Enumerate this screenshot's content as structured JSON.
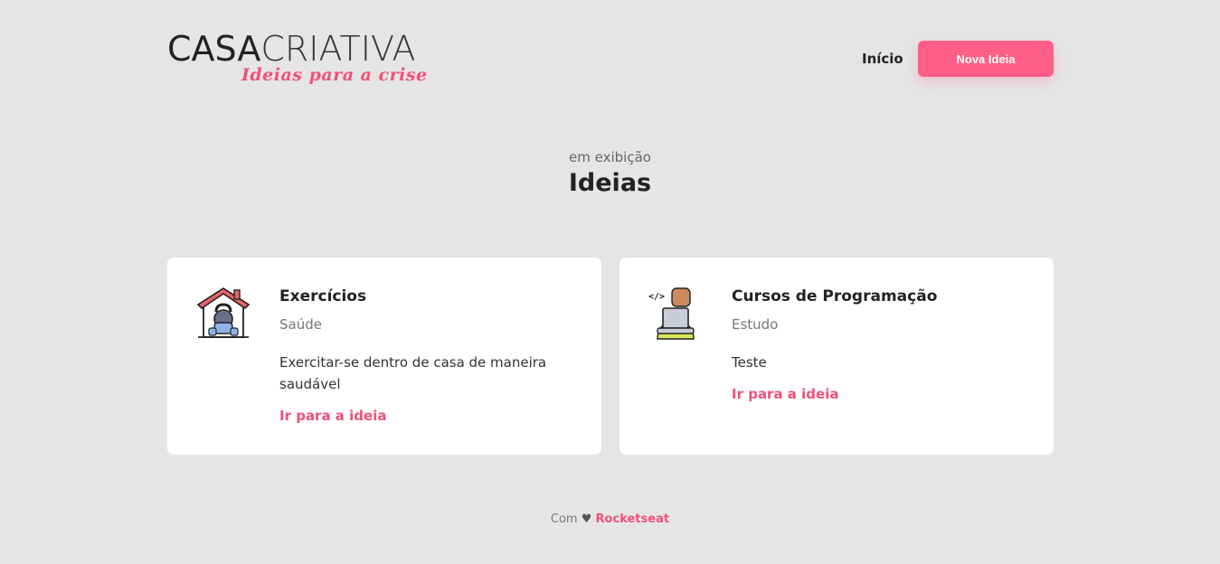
{
  "header": {
    "logo_bold": "CASA",
    "logo_light": "CRIATIVA",
    "logo_tagline": "Ideias para a crise",
    "nav_home": "Início",
    "new_idea_button": "Nova Ideia"
  },
  "section": {
    "subtitle": "em exibição",
    "title": "Ideias"
  },
  "ideas": [
    {
      "icon": "home-workout-icon",
      "title": "Exercícios",
      "category": "Saúde",
      "description": "Exercitar-se dentro de casa de maneira saudável",
      "link": "Ir para a ideia"
    },
    {
      "icon": "programmer-icon",
      "title": "Cursos de Programação",
      "category": "Estudo",
      "description": "Teste",
      "link": "Ir para a ideia"
    }
  ],
  "footer": {
    "prefix": "Com",
    "heart": "♥",
    "brand": "Rocketseat"
  },
  "colors": {
    "accent": "#ff5f86",
    "background": "#e5e5e5",
    "card": "#ffffff"
  }
}
